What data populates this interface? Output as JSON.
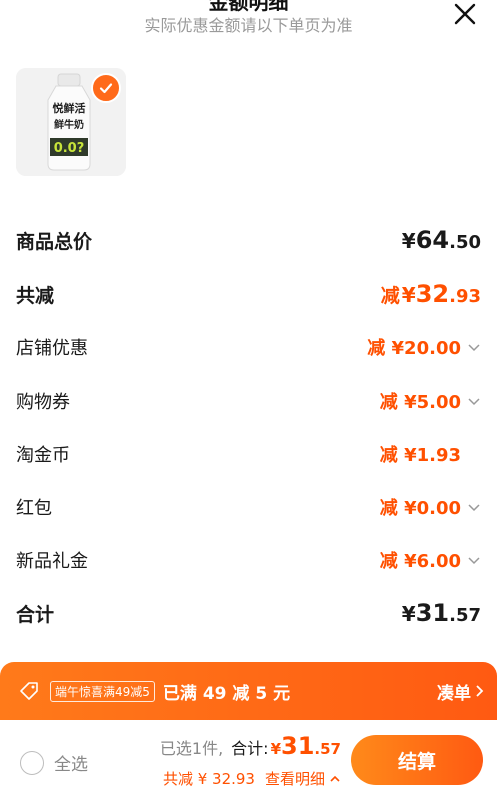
{
  "header": {
    "title": "金额明细",
    "subtitle": "实际优惠金额请以下单页为准"
  },
  "product": {
    "brand_text": "悦鲜活",
    "sub_text": "鲜牛奶",
    "badge_text": "0.0?"
  },
  "colors": {
    "accent": "#ff5000",
    "gradient_start": "#ff7a1a"
  },
  "rows": {
    "total": {
      "label": "商品总价",
      "currency": "¥",
      "int": "64",
      "dec": ".50"
    },
    "reduced": {
      "label": "共减",
      "minus": "减",
      "currency": "¥",
      "int": "32",
      "dec": ".93"
    },
    "shop": {
      "label": "店铺优惠",
      "amount": "减 ¥20.00"
    },
    "coupon": {
      "label": "购物券",
      "amount": "减 ¥5.00"
    },
    "coins": {
      "label": "淘金币",
      "amount": "减 ¥1.93"
    },
    "redpack": {
      "label": "红包",
      "amount": "减 ¥0.00"
    },
    "newgift": {
      "label": "新品礼金",
      "amount": "减 ¥6.00"
    },
    "sum": {
      "label": "合计",
      "currency": "¥",
      "int": "31",
      "dec": ".57"
    }
  },
  "promo": {
    "tag": "端午惊喜满49减5",
    "text": "已满 49 减 5 元",
    "link": "凑单"
  },
  "bottom": {
    "select_all": "全选",
    "selected": "已选1件,",
    "total_label": "合计:",
    "currency": "¥",
    "int": "31",
    "dec": ".57",
    "reduced": "共减 ¥ 32.93",
    "detail": "查看明细",
    "checkout": "结算"
  }
}
